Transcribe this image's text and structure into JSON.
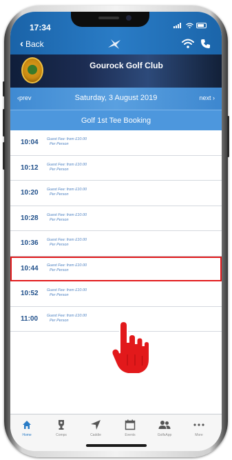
{
  "status_bar": {
    "time": "17:34"
  },
  "nav": {
    "back_label": "Back"
  },
  "club": {
    "name": "Gourock Golf Club"
  },
  "date_nav": {
    "prev_label": "prev",
    "date": "Saturday, 3 August 2019",
    "next_label": "next"
  },
  "section": {
    "title": "Golf 1st Tee Booking"
  },
  "tee_times": [
    {
      "time": "10:04",
      "fee": "Guest Fee: from £10.00",
      "per": "Per Person"
    },
    {
      "time": "10:12",
      "fee": "Guest Fee: from £10.00",
      "per": "Per Person"
    },
    {
      "time": "10:20",
      "fee": "Guest Fee: from £10.00",
      "per": "Per Person"
    },
    {
      "time": "10:28",
      "fee": "Guest Fee: from £10.00",
      "per": "Per Person"
    },
    {
      "time": "10:36",
      "fee": "Guest Fee: from £10.00",
      "per": "Per Person"
    },
    {
      "time": "10:44",
      "fee": "Guest Fee: from £10.00",
      "per": "Per Person",
      "highlighted": true
    },
    {
      "time": "10:52",
      "fee": "Guest Fee: from £10.00",
      "per": "Per Person"
    },
    {
      "time": "11:00",
      "fee": "Guest Fee: from £10.00",
      "per": "Per Person"
    }
  ],
  "tab_bar": {
    "tabs": [
      {
        "label": "Home",
        "icon": "home-icon",
        "active": true
      },
      {
        "label": "Comps",
        "icon": "trophy-icon"
      },
      {
        "label": "Caddie",
        "icon": "location-arrow-icon"
      },
      {
        "label": "Events",
        "icon": "calendar-icon"
      },
      {
        "label": "GolfsApp",
        "icon": "members-icon"
      },
      {
        "label": "More",
        "icon": "more-dots-icon"
      }
    ]
  },
  "colors": {
    "brand_blue": "#2a7cc6",
    "highlight_red": "#e2191b",
    "time_text": "#1f4f8a"
  }
}
